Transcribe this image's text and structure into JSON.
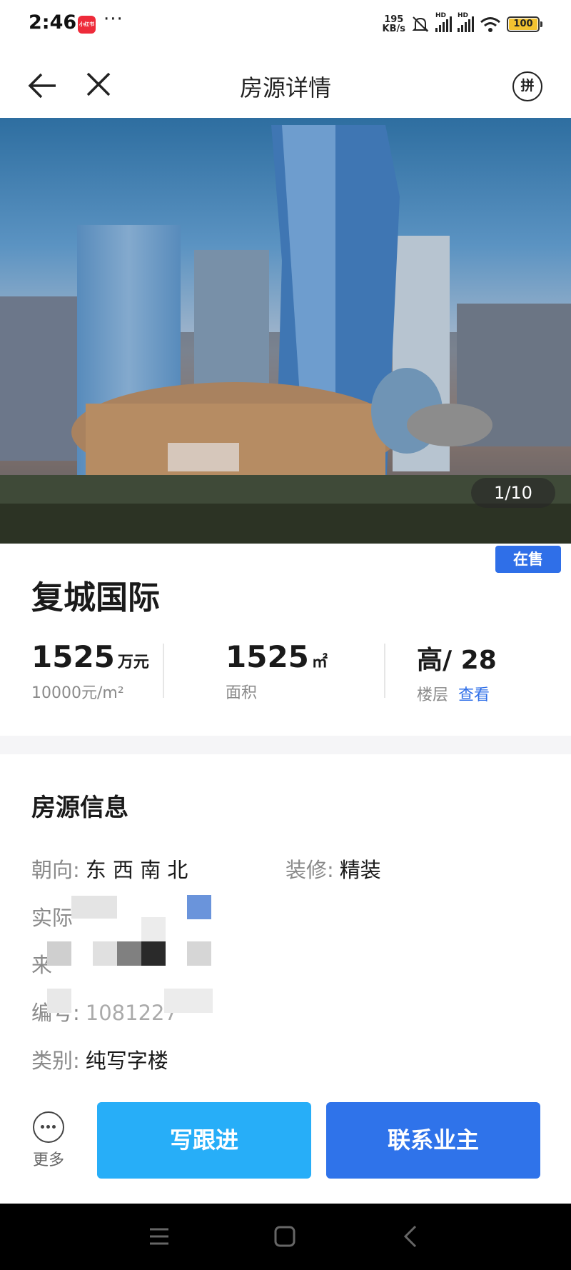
{
  "status_bar": {
    "time": "2:46",
    "app_badge": "小红书",
    "dots": "···",
    "net_speed_value": "195",
    "net_speed_unit": "KB/s",
    "hd_label": "HD",
    "battery": "100"
  },
  "nav": {
    "title": "房源详情",
    "pin_icon_text": "拼"
  },
  "hero": {
    "counter": "1/10"
  },
  "listing": {
    "status_tag": "在售",
    "title": "复城国际",
    "price_value": "1525",
    "price_unit": "万元",
    "unit_price": "10000元/m²",
    "area_value": "1525",
    "area_unit": "㎡",
    "area_label": "面积",
    "floor_value": "高/ 28",
    "floor_label": "楼层",
    "floor_link": "查看"
  },
  "info": {
    "section_title": "房源信息",
    "orientation_label": "朝向:",
    "orientation_value": "东 西 南 北",
    "decoration_label": "装修:",
    "decoration_value": "精装",
    "actual_label": "实际",
    "source_label": "来",
    "code_label": "编号:",
    "code_value": "1081227",
    "category_label": "类别:",
    "category_value": "纯写字楼"
  },
  "actions": {
    "more_label": "更多",
    "follow_label": "写跟进",
    "contact_label": "联系业主"
  },
  "colors": {
    "accent_blue": "#2f73ea",
    "follow_blue": "#27aef8",
    "tag_blue": "#2f6fe8"
  }
}
